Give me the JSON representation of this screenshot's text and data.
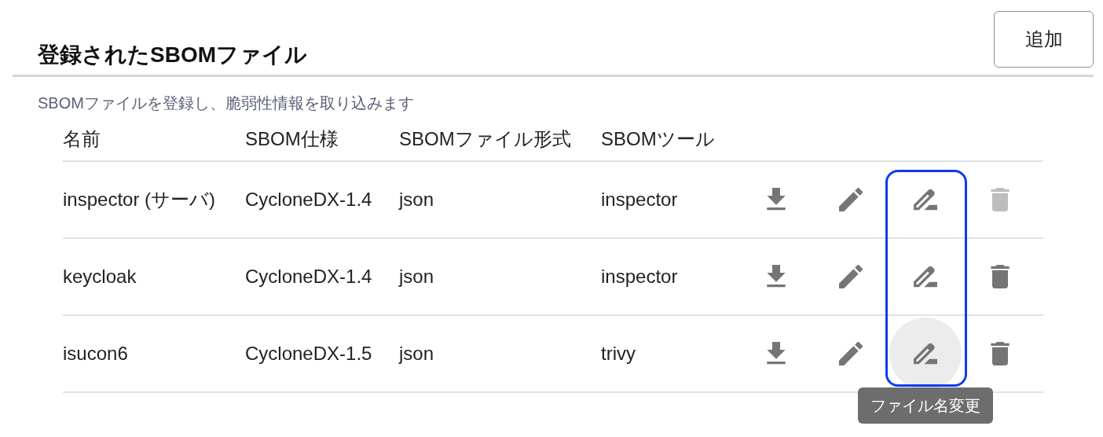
{
  "header": {
    "title": "登録されたSBOMファイル",
    "add_button": "追加"
  },
  "description": "SBOMファイルを登録し、脆弱性情報を取り込みます",
  "table": {
    "columns": [
      "名前",
      "SBOM仕様",
      "SBOMファイル形式",
      "SBOMツール"
    ],
    "rename_column_highlighted": true,
    "rows": [
      {
        "name": "inspector (サーバ)",
        "spec": "CycloneDX-1.4",
        "format": "json",
        "tool": "inspector",
        "delete_disabled": true,
        "rename_hovered": false
      },
      {
        "name": "keycloak",
        "spec": "CycloneDX-1.4",
        "format": "json",
        "tool": "inspector",
        "delete_disabled": false,
        "rename_hovered": false
      },
      {
        "name": "isucon6",
        "spec": "CycloneDX-1.5",
        "format": "json",
        "tool": "trivy",
        "delete_disabled": false,
        "rename_hovered": true,
        "rename_tooltip": "ファイル名変更"
      }
    ]
  }
}
